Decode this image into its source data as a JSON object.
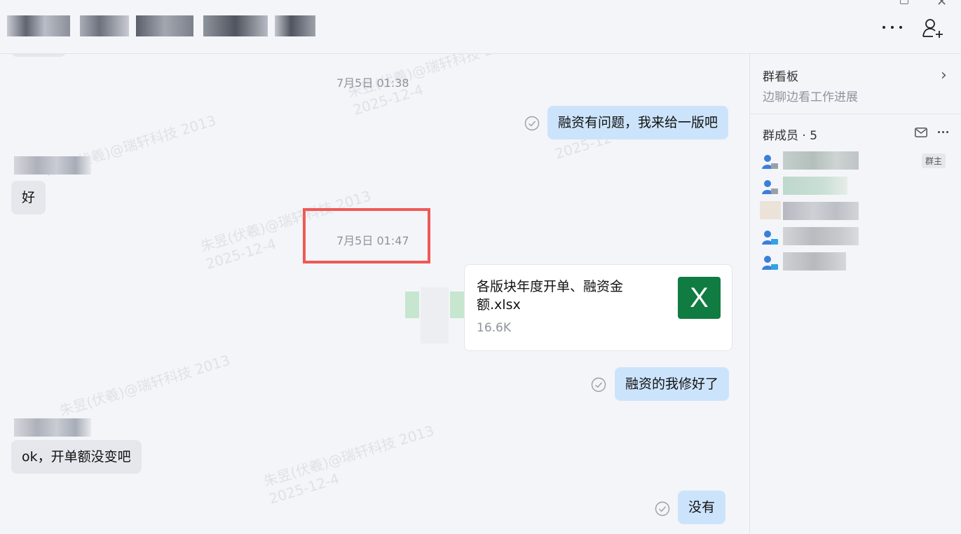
{
  "header": {
    "more_icon": "more-horizontal-icon",
    "add_member_icon": "add-member-icon"
  },
  "chat": {
    "timestamps": [
      "7月5日 01:38",
      "7月5日 01:47"
    ],
    "messages": [
      {
        "side": "me",
        "text": "融资有问题，我来给一版吧",
        "status": "read"
      },
      {
        "side": "other",
        "text": "好"
      },
      {
        "side": "me",
        "type": "file",
        "file_name": "各版块年度开单、融资金额.xlsx",
        "file_size": "16.6K",
        "file_icon": "excel-icon"
      },
      {
        "side": "me",
        "text": "融资的我修好了",
        "status": "read"
      },
      {
        "side": "other",
        "text": "ok，开单额没变吧"
      },
      {
        "side": "me",
        "text": "没有",
        "status": "read"
      }
    ],
    "watermark": {
      "name": "朱昱(伏羲)@瑞轩科技 2013",
      "date": "2025-12-4"
    }
  },
  "sidebar": {
    "board_title": "群看板",
    "board_subtitle": "边聊边看工作进展",
    "members_title": "群成员 · 5",
    "owner_badge": "群主"
  },
  "colors": {
    "my_bubble": "#cce4fb",
    "other_bubble": "#e6e7ec",
    "highlight": "#ef5a55",
    "excel_green": "#107c41"
  }
}
